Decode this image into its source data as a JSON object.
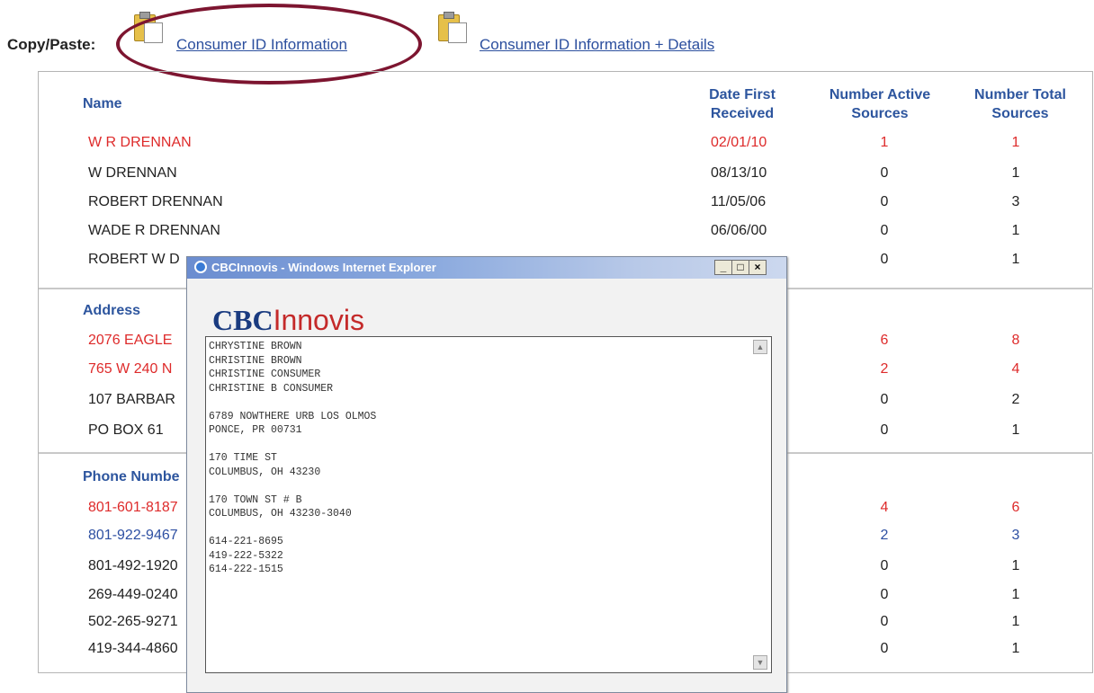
{
  "copybar": {
    "label": "Copy/Paste:",
    "links": [
      "Consumer ID Information",
      "Consumer ID Information + Details"
    ]
  },
  "headers": {
    "name": "Name",
    "date_first_received": "Date First Received",
    "number_active_sources": "Number Active Sources",
    "number_total_sources": "Number Total Sources",
    "address": "Address",
    "phone_number": "Phone Numbe"
  },
  "name_rows": [
    {
      "name": "W R DRENNAN",
      "date": "02/01/10",
      "active": "1",
      "total": "1"
    },
    {
      "name": "W DRENNAN",
      "date": "08/13/10",
      "active": "0",
      "total": "1"
    },
    {
      "name": "ROBERT DRENNAN",
      "date": "11/05/06",
      "active": "0",
      "total": "3"
    },
    {
      "name": "WADE R DRENNAN",
      "date": "06/06/00",
      "active": "0",
      "total": "1"
    },
    {
      "name": "ROBERT W D",
      "active": "0",
      "total": "1"
    }
  ],
  "address_rows": [
    {
      "address": "2076 EAGLE",
      "active": "6",
      "total": "8"
    },
    {
      "address": "765 W 240 N",
      "active": "2",
      "total": "4"
    },
    {
      "address": "107 BARBAR",
      "active": "0",
      "total": "2"
    },
    {
      "address": "PO BOX 61",
      "active": "0",
      "total": "1"
    }
  ],
  "phone_rows": [
    {
      "phone": "801-601-8187",
      "active": "4",
      "total": "6"
    },
    {
      "phone": "801-922-9467",
      "active": "2",
      "total": "3"
    },
    {
      "phone": "801-492-1920",
      "active": "0",
      "total": "1"
    },
    {
      "phone": "269-449-0240",
      "active": "0",
      "total": "1"
    },
    {
      "phone": "502-265-9271",
      "active": "0",
      "total": "1"
    },
    {
      "phone": "419-344-4860",
      "active": "0",
      "total": "1"
    }
  ],
  "popup": {
    "title": "CBCInnovis - Windows Internet Explorer",
    "logo_cbc": "CBC",
    "logo_innovis": "Innovis",
    "minimize": "_",
    "maximize": "□",
    "close": "×",
    "scroll_up": "▲",
    "scroll_down": "▼",
    "text": "CHRYSTINE BROWN\nCHRISTINE BROWN\nCHRISTINE CONSUMER\nCHRISTINE B CONSUMER\n\n6789 NOWTHERE URB LOS OLMOS\nPONCE, PR 00731\n\n170 TIME ST\nCOLUMBUS, OH 43230\n\n170 TOWN ST # B\nCOLUMBUS, OH 43230-3040\n\n614-221-8695\n419-222-5322\n614-222-1515"
  },
  "colors": {
    "highlight_ring": "#7d1530",
    "red_text": "#de2b2b",
    "blue_text": "#2d4fa2",
    "header_blue": "#2d559e"
  },
  "icons": [
    "clipboard-icon",
    "ie-icon"
  ]
}
